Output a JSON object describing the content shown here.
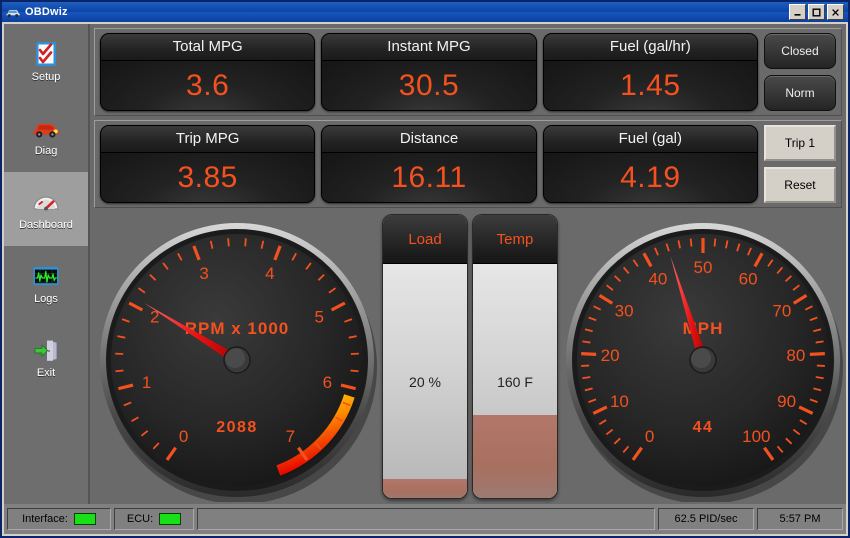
{
  "window": {
    "title": "OBDwiz",
    "icon": "car-icon",
    "minimize_label": "_",
    "maximize_label": "□",
    "close_label": "✕"
  },
  "sidebar": {
    "items": [
      {
        "label": "Setup",
        "icon": "checklist-icon",
        "selected": false
      },
      {
        "label": "Diag",
        "icon": "car-icon",
        "selected": false
      },
      {
        "label": "Dashboard",
        "icon": "gauge-icon",
        "selected": true
      },
      {
        "label": "Logs",
        "icon": "waveform-icon",
        "selected": false
      },
      {
        "label": "Exit",
        "icon": "exit-door-icon",
        "selected": false
      }
    ]
  },
  "readouts": {
    "row1": [
      {
        "label": "Total MPG",
        "value": "3.6"
      },
      {
        "label": "Instant MPG",
        "value": "30.5"
      },
      {
        "label": "Fuel (gal/hr)",
        "value": "1.45"
      }
    ],
    "row2": [
      {
        "label": "Trip MPG",
        "value": "3.85"
      },
      {
        "label": "Distance",
        "value": "16.11"
      },
      {
        "label": "Fuel (gal)",
        "value": "4.19"
      }
    ]
  },
  "status_buttons": {
    "loop_status": "Closed",
    "fuel_status": "Norm"
  },
  "trip_buttons": {
    "trip": "Trip 1",
    "reset": "Reset"
  },
  "bars": [
    {
      "name": "load",
      "label": "Load",
      "value_text": "20 %",
      "value": 20,
      "max": 100,
      "fill_percent": 9
    },
    {
      "name": "temp",
      "label": "Temp",
      "value_text": "160 F",
      "value": 160,
      "max": 260,
      "fill_percent": 36
    }
  ],
  "chart_data": [
    {
      "type": "gauge",
      "name": "tachometer",
      "title": "RPM x 1000",
      "value": 2088,
      "value_text": "2088",
      "needle_value": 2.088,
      "unit": "RPM",
      "scale_min": 0,
      "scale_max": 7,
      "tick_labels": [
        "0",
        "1",
        "2",
        "3",
        "4",
        "5",
        "6",
        "7"
      ],
      "major_step": 1,
      "minor_per_major": 4,
      "redline_start": 6.1,
      "redline_end": 7.35,
      "start_angle_deg": 125,
      "end_angle_deg": 415,
      "needle_color": "#e02020",
      "tick_color": "#f4511e",
      "face_color": "#262626"
    },
    {
      "type": "gauge",
      "name": "speedometer",
      "title": "MPH",
      "value": 44,
      "value_text": "44",
      "needle_value": 44,
      "unit": "MPH",
      "scale_min": 0,
      "scale_max": 100,
      "tick_labels": [
        "0",
        "10",
        "20",
        "30",
        "40",
        "50",
        "60",
        "70",
        "80",
        "90",
        "100"
      ],
      "major_step": 10,
      "minor_per_major": 4,
      "redline_start": null,
      "redline_end": null,
      "start_angle_deg": 125,
      "end_angle_deg": 415,
      "needle_color": "#e02020",
      "tick_color": "#f4511e",
      "face_color": "#262626"
    }
  ],
  "statusbar": {
    "interface_label": "Interface:",
    "interface_state": "connected",
    "ecu_label": "ECU:",
    "ecu_state": "connected",
    "pid_rate": "62.5 PID/sec",
    "clock": "5:57 PM"
  },
  "colors": {
    "accent_orange": "#f4511e",
    "needle_red": "#e02020",
    "led_green": "#18e018",
    "panel_gray": "#6a6a6a",
    "title_blue": "#0a44a8"
  }
}
